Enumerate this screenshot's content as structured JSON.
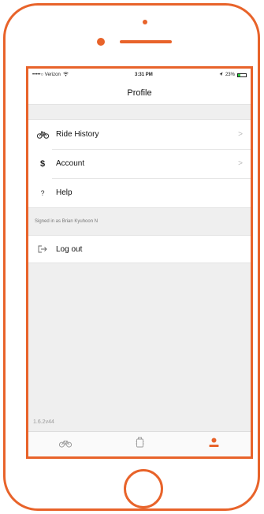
{
  "status_bar": {
    "carrier": "•••••○ Verizon",
    "time": "3:31 PM",
    "battery": "23%"
  },
  "nav": {
    "title": "Profile"
  },
  "menu": {
    "items": [
      {
        "label": "Ride History",
        "icon": "bicycle-icon"
      },
      {
        "label": "Account",
        "icon": "dollar-icon"
      },
      {
        "label": "Help",
        "icon": "question-icon"
      }
    ]
  },
  "signed_in_text": "Signed in as Brian Kyuhoon N",
  "logout_label": "Log out",
  "version": "1.6.2v44",
  "tabs": [
    {
      "name": "tab-rides",
      "icon": "bicycle-icon",
      "active": false
    },
    {
      "name": "tab-lock",
      "icon": "lock-icon",
      "active": false
    },
    {
      "name": "tab-profile",
      "icon": "person-icon",
      "active": true
    }
  ],
  "colors": {
    "accent": "#e8632a",
    "background": "#efefef",
    "cell": "#ffffff"
  }
}
